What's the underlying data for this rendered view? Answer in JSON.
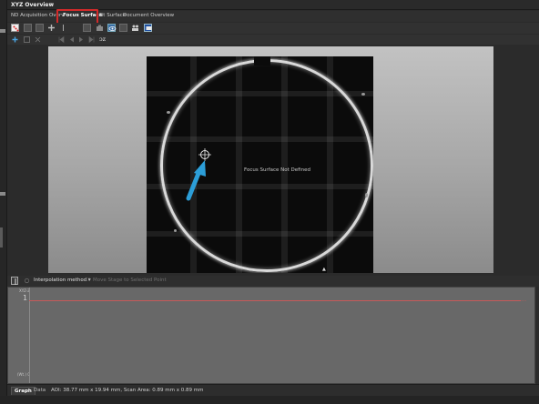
{
  "window": {
    "title": "XYZ Overview",
    "close_glyph": "×"
  },
  "tabs": [
    {
      "label": "ND Acquisition Overview",
      "active": false
    },
    {
      "label": "Focus Surface",
      "active": true
    },
    {
      "label": "Fit Surface",
      "active": false
    },
    {
      "label": "Document Overview",
      "active": false
    }
  ],
  "tab_labels": {
    "nd_acquisition": "ND Acquisition Overv",
    "focus_surface": "Focus Surface",
    "fit_surface": "Fit Surface",
    "document_overview": "Document Overview"
  },
  "toolbar2": {
    "scale_text": "ㄹ",
    "text_label": "ↄz"
  },
  "viewer": {
    "message": "Focus Surface Not Defined"
  },
  "lower_toolbar": {
    "interpolation_label": "Interpolation method ▾",
    "move_stage_label": "Move Stage to Selected Point"
  },
  "graph": {
    "y_top_label": "XYZ-Z",
    "y_bottom_label": "(Wt.) 0",
    "y_tick": "1",
    "right_marker": "-----"
  },
  "status_bar": {
    "graph_tab": "Graph",
    "data_tab": "Data",
    "info": "AOI: 38.77 mm x 19.94 mm, Scan Area: 0.89 mm x 0.89 mm"
  },
  "colors": {
    "highlight_box": "#d22a2a",
    "arrow": "#2c9ed8",
    "graph_line": "#c75a5a",
    "panel_bg": "#2b2b2b"
  },
  "icons": {
    "arrow": "arrow-icon",
    "crosshair": "crosshair-icon"
  }
}
